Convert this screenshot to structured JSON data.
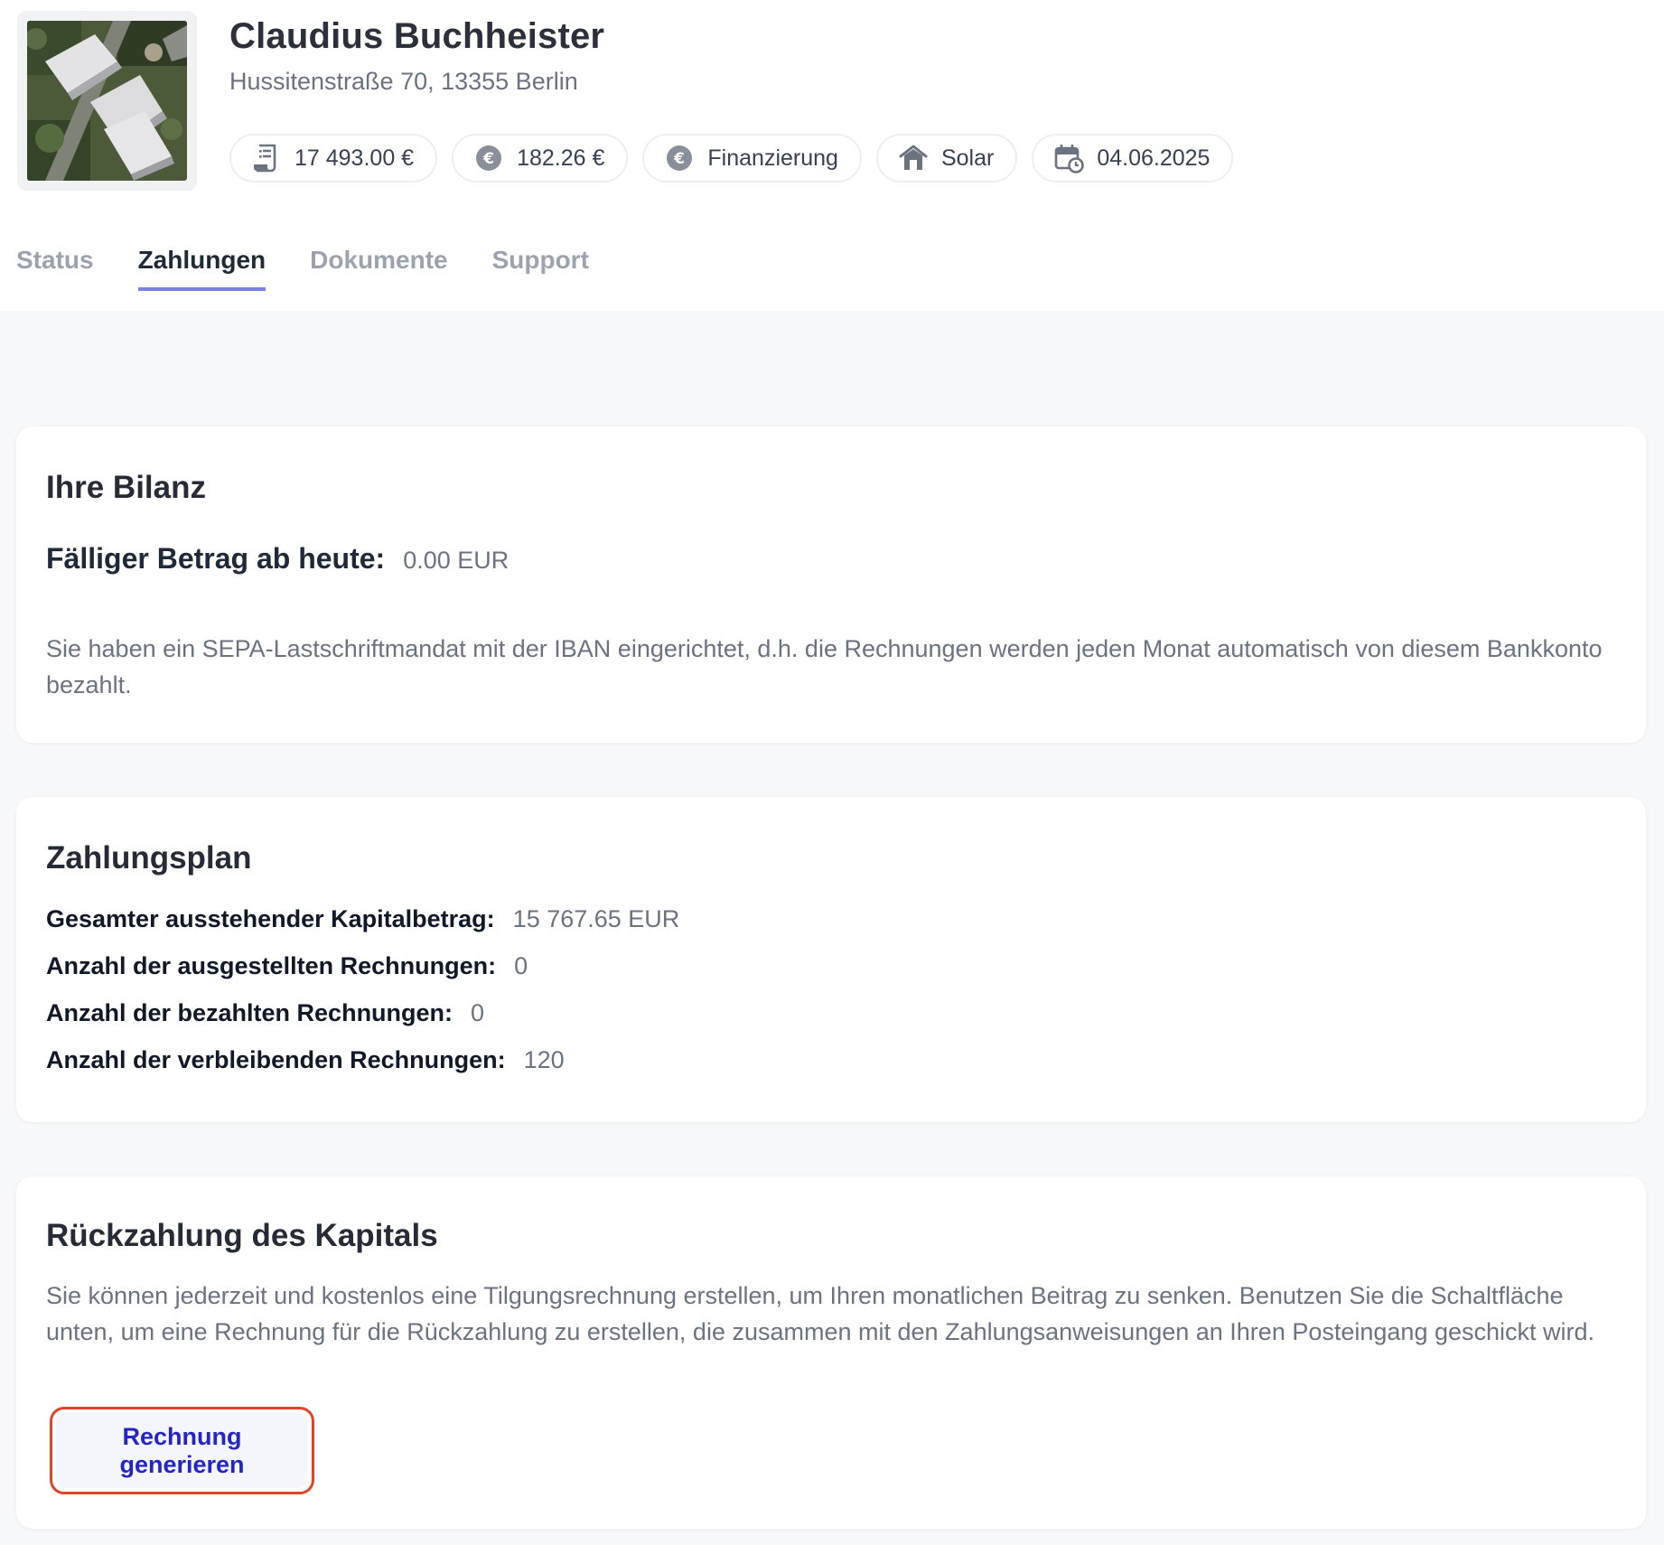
{
  "customer": {
    "name": "Claudius Buchheister",
    "address": "Hussitenstraße 70, 13355 Berlin"
  },
  "pills": [
    {
      "icon": "invoice-icon",
      "label": "17 493.00 €"
    },
    {
      "icon": "euro-coin-icon",
      "label": "182.26 €"
    },
    {
      "icon": "euro-coin-icon",
      "label": "Finanzierung"
    },
    {
      "icon": "house-icon",
      "label": "Solar"
    },
    {
      "icon": "calendar-clock-icon",
      "label": "04.06.2025"
    }
  ],
  "tabs": [
    {
      "label": "Status",
      "active": false
    },
    {
      "label": "Zahlungen",
      "active": true
    },
    {
      "label": "Dokumente",
      "active": false
    },
    {
      "label": "Support",
      "active": false
    }
  ],
  "bilanz": {
    "title": "Ihre Bilanz",
    "due_label": "Fälliger Betrag ab heute:",
    "due_value": "0.00 EUR",
    "note": "Sie haben ein SEPA-Lastschriftmandat mit der IBAN eingerichtet, d.h. die Rechnungen werden jeden Monat automatisch von diesem Bankkonto bezahlt."
  },
  "plan": {
    "title": "Zahlungsplan",
    "rows": [
      {
        "label": "Gesamter ausstehender Kapitalbetrag:",
        "value": "15 767.65 EUR"
      },
      {
        "label": "Anzahl der ausgestellten Rechnungen:",
        "value": "0"
      },
      {
        "label": "Anzahl der bezahlten Rechnungen:",
        "value": "0"
      },
      {
        "label": "Anzahl der verbleibenden Rechnungen:",
        "value": "120"
      }
    ]
  },
  "repayment": {
    "title": "Rückzahlung des Kapitals",
    "text": "Sie können jederzeit und kostenlos eine Tilgungsrechnung erstellen, um Ihren monatlichen Beitrag zu senken. Benutzen Sie die Schaltfläche unten, um eine Rechnung für die Rückzahlung zu erstellen, die zusammen mit den Zahlungsanweisungen an Ihren Posteingang geschickt wird.",
    "button_label": "Rechnung generieren"
  },
  "colors": {
    "tab_underline": "#7c80e6",
    "button_text": "#2424c9",
    "button_highlight_border": "#e0452a"
  }
}
